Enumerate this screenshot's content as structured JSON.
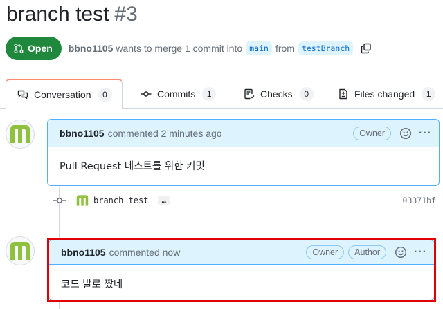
{
  "pr": {
    "title": "branch test",
    "number": "#3",
    "state": "Open",
    "author": "bbno1105",
    "merge_text": "wants to merge 1 commit into",
    "base_branch": "main",
    "from_text": "from",
    "head_branch": "testBranch"
  },
  "tabs": [
    {
      "label": "Conversation",
      "count": "0",
      "icon": "comment-discussion-icon"
    },
    {
      "label": "Commits",
      "count": "1",
      "icon": "commit-icon"
    },
    {
      "label": "Checks",
      "count": "0",
      "icon": "checklist-icon"
    },
    {
      "label": "Files changed",
      "count": "1",
      "icon": "file-diff-icon"
    }
  ],
  "comments": [
    {
      "author": "bbno1105",
      "action": "commented 2 minutes ago",
      "badges": [
        "Owner"
      ],
      "body": "Pull Request 테스트를 위한 커밋"
    },
    {
      "author": "bbno1105",
      "action": "commented now",
      "badges": [
        "Owner",
        "Author"
      ],
      "body": "코드 발로 짰네"
    }
  ],
  "commit": {
    "message": "branch test",
    "ellipsis": "…",
    "sha": "03371bf"
  },
  "colors": {
    "open_green": "#1f883d",
    "accent_blue": "#0969da",
    "header_blue": "#ddf4ff",
    "highlight_red": "#e00000",
    "avatar_green": "#8fc13e"
  }
}
